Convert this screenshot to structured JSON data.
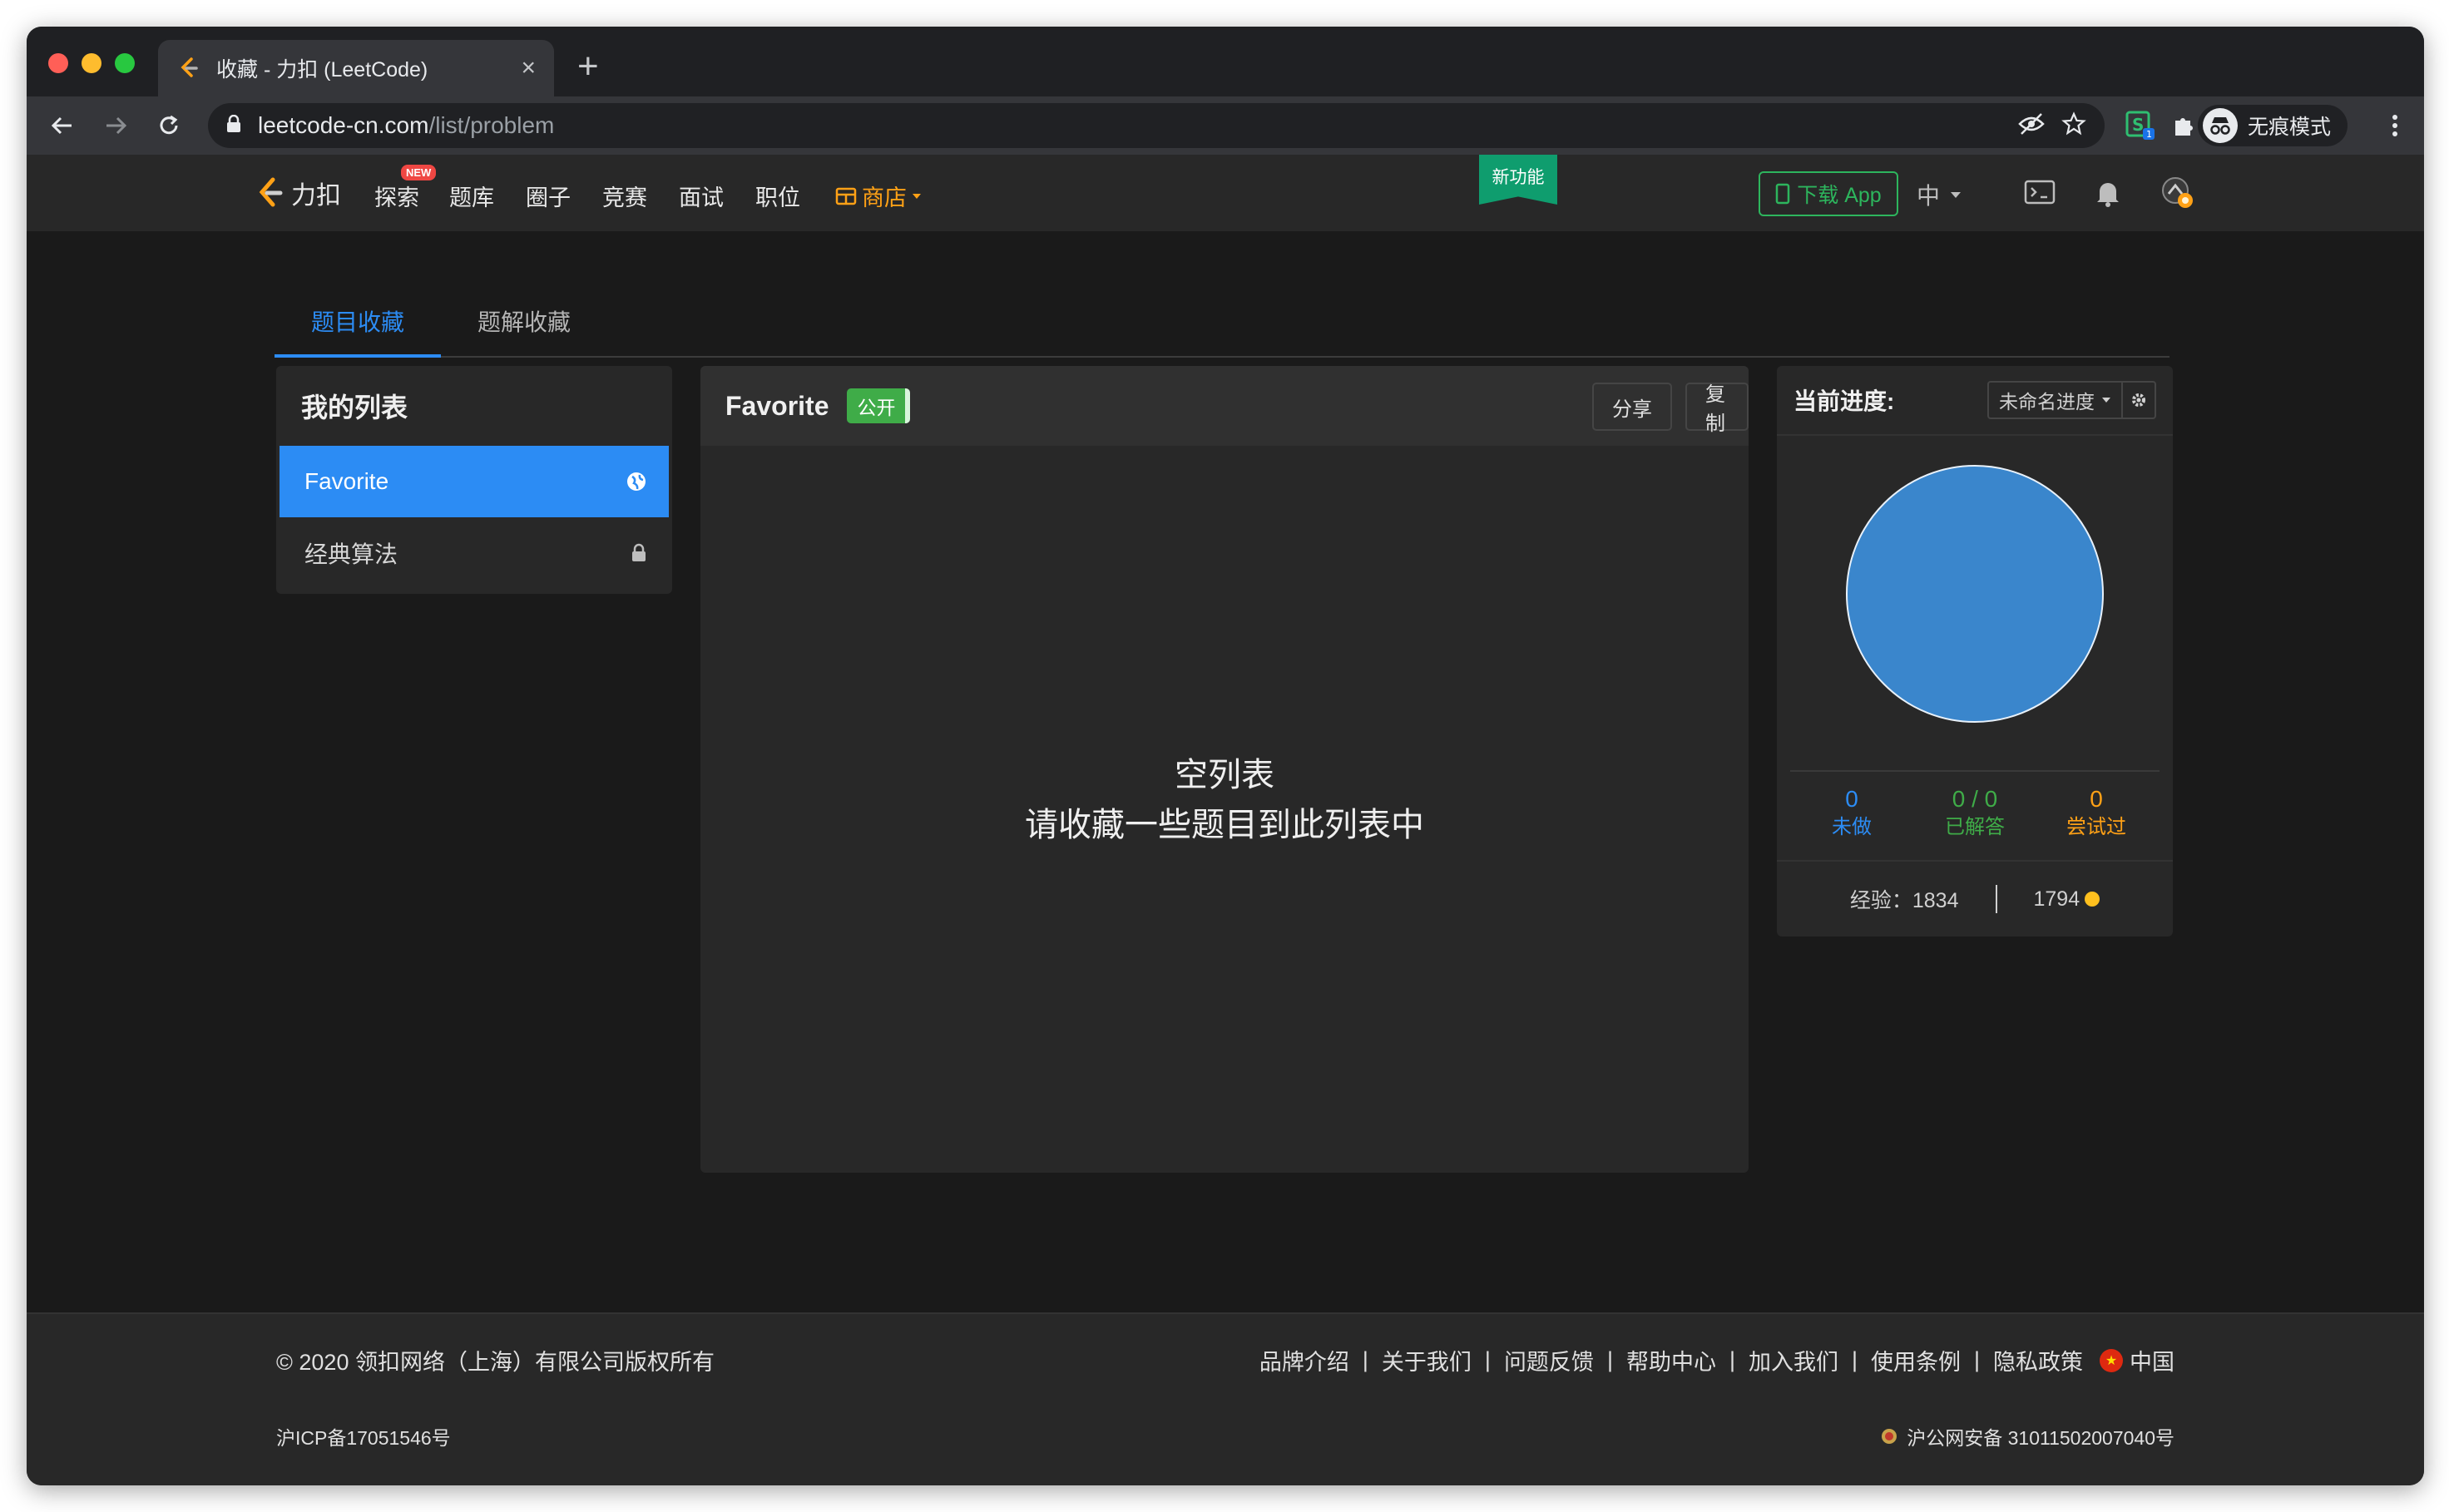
{
  "browser": {
    "tab_title": "收藏 - 力扣 (LeetCode)",
    "new_tab": "+",
    "url_domain": "leetcode-cn.com",
    "url_path": "/list/problem",
    "incognito_label": "无痕模式",
    "extension_badge": "1"
  },
  "site_nav": {
    "logo_text": "力扣",
    "new_badge": "NEW",
    "items": [
      "探索",
      "题库",
      "圈子",
      "竞赛",
      "面试",
      "职位"
    ],
    "store": "商店",
    "ribbon": "新功能",
    "download": "下载 App",
    "lang": "中"
  },
  "page_tabs": {
    "active": "题目收藏",
    "inactive": "题解收藏"
  },
  "my_lists": {
    "title": "我的列表",
    "items": [
      {
        "label": "Favorite",
        "icon": "globe-icon"
      },
      {
        "label": "经典算法",
        "icon": "lock-icon"
      }
    ]
  },
  "favorite": {
    "name": "Favorite",
    "public_badge": "公开",
    "share": "分享",
    "copy": "复制",
    "empty_title": "空列表",
    "empty_hint": "请收藏一些题目到此列表中"
  },
  "progress": {
    "label": "当前进度:",
    "session": "未命名进度",
    "stats": [
      {
        "value": "0",
        "caption": "未做",
        "color": "#2c8cf4"
      },
      {
        "value": "0 / 0",
        "caption": "已解答",
        "color": "#3fac48"
      },
      {
        "value": "0",
        "caption": "尝试过",
        "color": "#ffa116"
      }
    ],
    "experience": "经验：1834",
    "coins": "1794",
    "pie_color": "#3a86cc"
  },
  "footer": {
    "copyright": "© 2020 领扣网络（上海）有限公司版权所有",
    "icp": "沪ICP备17051546号",
    "links": [
      "品牌介绍",
      "关于我们",
      "问题反馈",
      "帮助中心",
      "加入我们",
      "使用条例",
      "隐私政策"
    ],
    "region": "中国",
    "gongan": "沪公网安备 31011502007040号"
  }
}
